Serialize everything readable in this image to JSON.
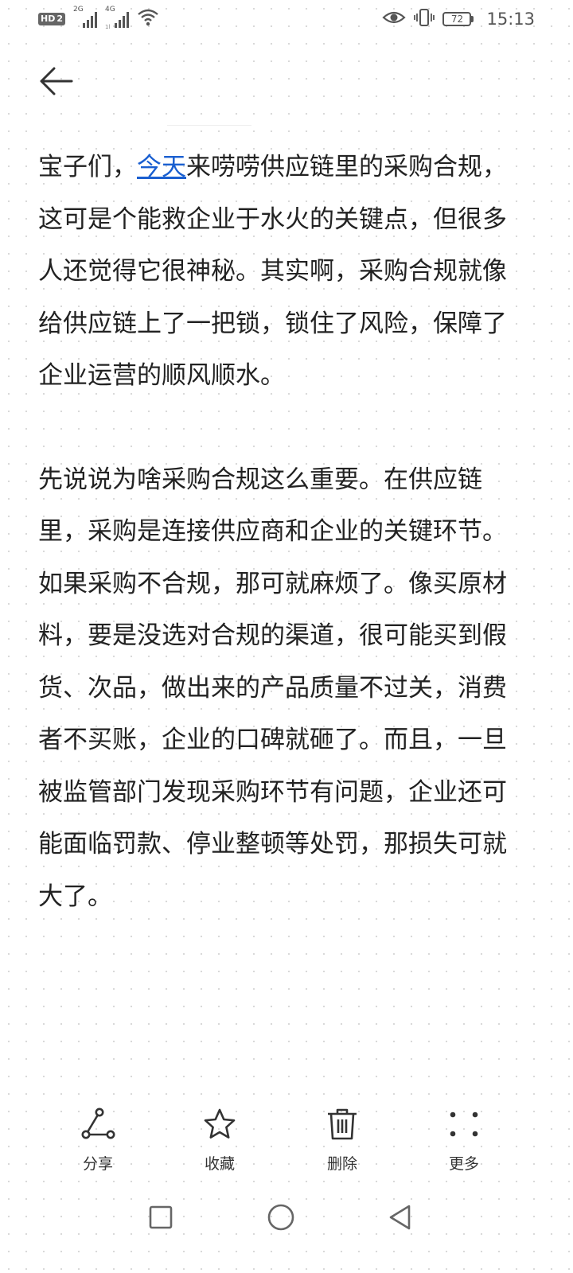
{
  "status_bar": {
    "hd_label": "HD",
    "hd_sim": "2",
    "net1_label": "2G",
    "net2_label": "4G",
    "net2_sub": "1l",
    "battery_level": "72",
    "time": "15:13"
  },
  "icons": {
    "back": "arrow-left-icon",
    "share": "share-icon",
    "favorite": "star-icon",
    "delete": "trash-icon",
    "more": "more-dots-icon"
  },
  "content": {
    "p1_before": "宝子们，",
    "p1_link": "今天",
    "p1_after": "来唠唠供应链里的采购合规，这可是个能救企业于水火的关键点，但很多人还觉得它很神秘。其实啊，采购合规就像给供应链上了一把锁，锁住了风险，保障了企业运营的顺风顺水。",
    "p2": "先说说为啥采购合规这么重要。在供应链里，采购是连接供应商和企业的关键环节。如果采购不合规，那可就麻烦了。像买原材料，要是没选对合规的渠道，很可能买到假货、次品，做出来的产品质量不过关，消费者不买账，企业的口碑就砸了。而且，一旦被监管部门发现采购环节有问题，企业还可能面临罚款、停业整顿等处罚，那损失可就大了。"
  },
  "toolbar": {
    "share_label": "分享",
    "favorite_label": "收藏",
    "delete_label": "删除",
    "more_label": "更多"
  },
  "nav": {
    "recent": "square-icon",
    "home": "circle-icon",
    "back": "triangle-back-icon"
  }
}
